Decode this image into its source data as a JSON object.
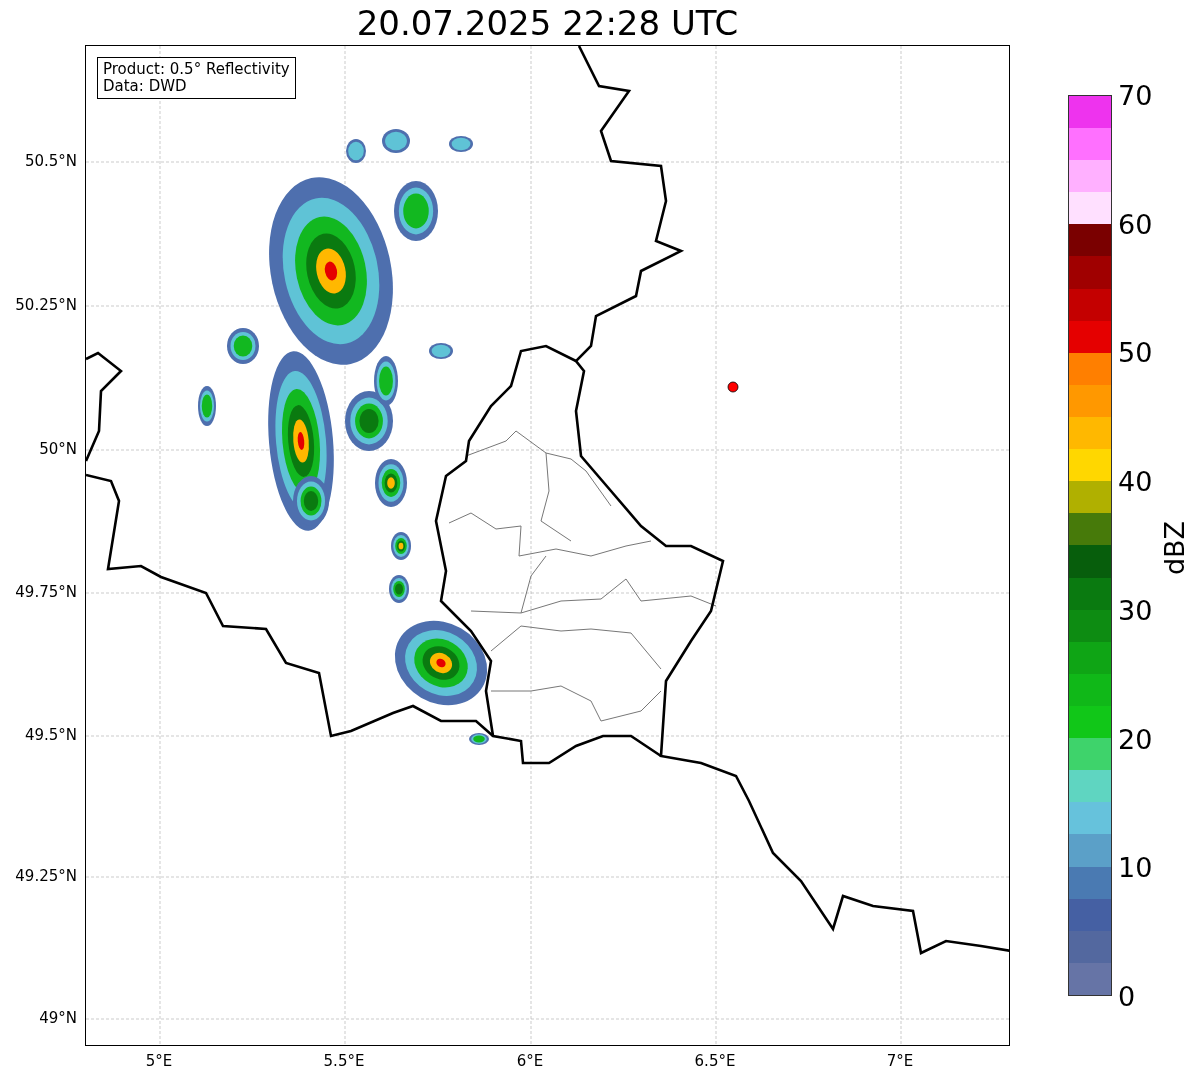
{
  "title": "20.07.2025 22:28 UTC",
  "legend": [
    "Product: 0.5° Reflectivity",
    "Data: DWD"
  ],
  "lat_labels": [
    "50.5°N",
    "50.25°N",
    "50°N",
    "49.75°N",
    "49.5°N",
    "49.25°N",
    "49°N"
  ],
  "lon_labels": [
    "5°E",
    "5.5°E",
    "6°E",
    "6.5°E",
    "7°E"
  ],
  "colorbar": {
    "label": "dBZ",
    "ticks": [
      "70",
      "60",
      "50",
      "40",
      "30",
      "20",
      "10",
      "0"
    ],
    "bands": [
      {
        "color": "#6674a6"
      },
      {
        "color": "#53689f"
      },
      {
        "color": "#4560a3"
      },
      {
        "color": "#4a7ab2"
      },
      {
        "color": "#5ba0c8"
      },
      {
        "color": "#66c2dc"
      },
      {
        "color": "#5fd5c1"
      },
      {
        "color": "#3ed36b"
      },
      {
        "color": "#11c718"
      },
      {
        "color": "#10b818"
      },
      {
        "color": "#0fa515"
      },
      {
        "color": "#0d8c12"
      },
      {
        "color": "#0a7a10"
      },
      {
        "color": "#075e0c"
      },
      {
        "color": "#477a0a"
      },
      {
        "color": "#b0b000"
      },
      {
        "color": "#ffd700"
      },
      {
        "color": "#ffb800"
      },
      {
        "color": "#ff9800"
      },
      {
        "color": "#ff7f00"
      },
      {
        "color": "#e50000"
      },
      {
        "color": "#c40000"
      },
      {
        "color": "#a00000"
      },
      {
        "color": "#7a0000"
      },
      {
        "color": "#ffe0ff"
      },
      {
        "color": "#ffb0ff"
      },
      {
        "color": "#ff70ff"
      },
      {
        "color": "#ee33ee"
      }
    ]
  }
}
